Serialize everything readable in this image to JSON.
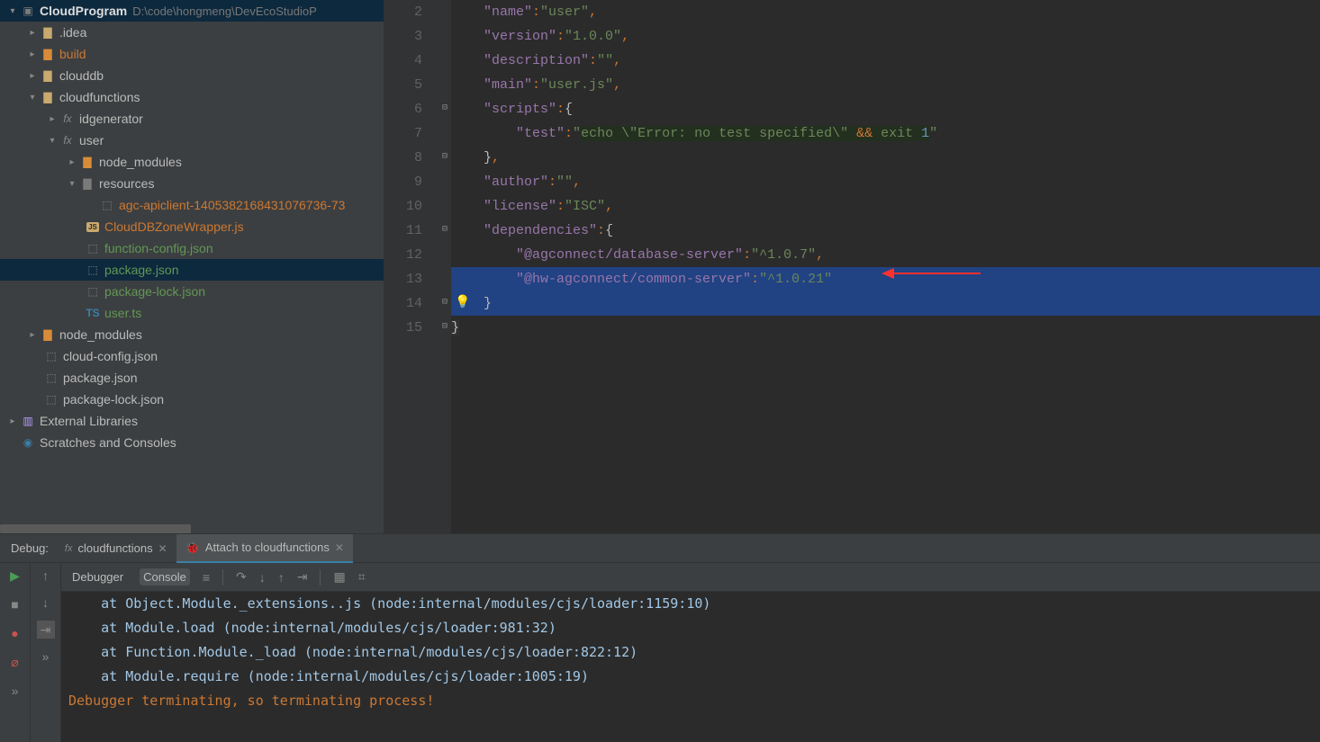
{
  "project": {
    "name": "CloudProgram",
    "path": "D:\\code\\hongmeng\\DevEcoStudioP"
  },
  "tree": {
    "idea": ".idea",
    "build": "build",
    "clouddb": "clouddb",
    "cloudfunctions": "cloudfunctions",
    "idgenerator": "idgenerator",
    "user": "user",
    "node_modules": "node_modules",
    "resources": "resources",
    "agc_client": "agc-apiclient-1405382168431076736-73",
    "cloud_wrapper": "CloudDBZoneWrapper.js",
    "func_config": "function-config.json",
    "package_json": "package.json",
    "package_lock": "package-lock.json",
    "user_ts": "user.ts",
    "root_node_modules": "node_modules",
    "cloud_config": "cloud-config.json",
    "root_package": "package.json",
    "root_package_lock": "package-lock.json",
    "ext_libs": "External Libraries",
    "scratches": "Scratches and Consoles"
  },
  "code": {
    "l2": {
      "key": "\"name\"",
      "sep": ":",
      "val": "\"user\"",
      "c": ","
    },
    "l3": {
      "key": "\"version\"",
      "sep": ":",
      "val": "\"1.0.0\"",
      "c": ","
    },
    "l4": {
      "key": "\"description\"",
      "sep": ":",
      "val": "\"\"",
      "c": ","
    },
    "l5": {
      "key": "\"main\"",
      "sep": ":",
      "val": "\"user.js\"",
      "c": ","
    },
    "l6": {
      "key": "\"scripts\"",
      "sep": ":",
      "brace": "{"
    },
    "l7": {
      "key": "\"test\"",
      "sep": ":",
      "q1": "\"",
      "echo": "echo ",
      "err": "\\\"Error: no test specified\\\" ",
      "amp": "&& ",
      "exit": "exit ",
      "one": "1",
      "q2": "\""
    },
    "l8": {
      "brace": "}",
      "c": ","
    },
    "l9": {
      "key": "\"author\"",
      "sep": ":",
      "val": "\"\"",
      "c": ","
    },
    "l10": {
      "key": "\"license\"",
      "sep": ":",
      "val": "\"ISC\"",
      "c": ","
    },
    "l11": {
      "key": "\"dependencies\"",
      "sep": ":",
      "brace": "{"
    },
    "l12": {
      "key": "\"@agconnect/database-server\"",
      "sep": ":",
      "val": "\"^1.0.7\"",
      "c": ","
    },
    "l13": {
      "key": "\"@hw-agconnect/common-server\"",
      "sep": ":",
      "val": "\"^1.0.21\""
    },
    "l14": {
      "brace": "}"
    },
    "l15": {
      "brace": "}"
    }
  },
  "line_numbers": [
    "2",
    "3",
    "4",
    "5",
    "6",
    "7",
    "8",
    "9",
    "10",
    "11",
    "12",
    "13",
    "14",
    "15"
  ],
  "debug": {
    "label": "Debug:",
    "tab1": "cloudfunctions",
    "tab2": "Attach to cloudfunctions",
    "debugger": "Debugger",
    "console": "Console",
    "lines": [
      "    at Object.Module._extensions..js (node:internal/modules/cjs/loader:1159:10)",
      "    at Module.load (node:internal/modules/cjs/loader:981:32)",
      "    at Function.Module._load (node:internal/modules/cjs/loader:822:12)",
      "    at Module.require (node:internal/modules/cjs/loader:1005:19)"
    ],
    "term_msg": "Debugger terminating, so terminating process!"
  }
}
